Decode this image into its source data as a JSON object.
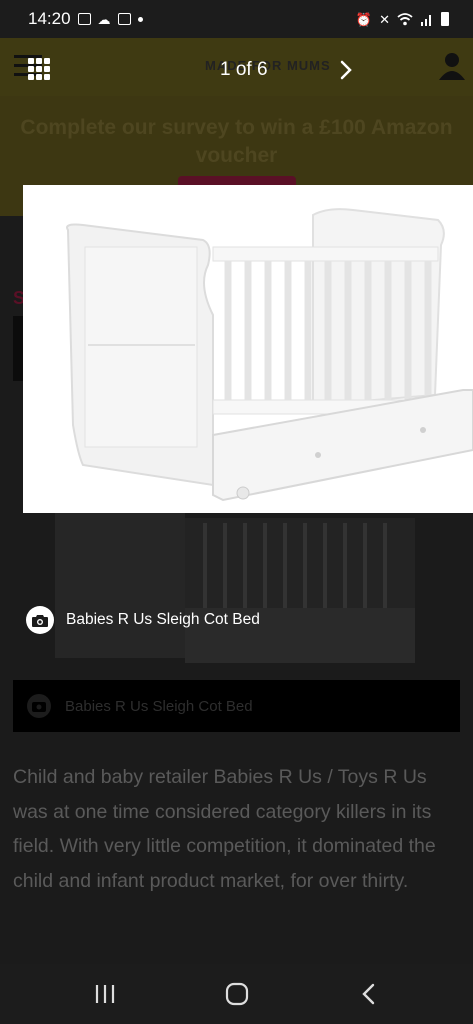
{
  "status_bar": {
    "time": "14:20",
    "left_icons": [
      "gallery-icon",
      "weather-icon",
      "mail-icon",
      "dot-icon"
    ],
    "right_icons": [
      "alarm-icon",
      "mute-icon",
      "wifi-icon",
      "signal-icon",
      "battery-icon"
    ]
  },
  "site": {
    "logo": "MADE FOR MUMS",
    "survey_text": "Complete our survey to win a £100 Amazon voucher",
    "article_letter": "S"
  },
  "overlay": {
    "counter": "1 of 6",
    "caption": "Babies R Us Sleigh Cot Bed"
  },
  "background_caption": "Babies R Us Sleigh Cot Bed",
  "article": {
    "text": "Child and baby retailer Babies R Us / Toys R Us was at one time considered category killers in its field.  With very little competition, it dominated the child and infant product market, for over thirty."
  },
  "nav": {
    "buttons": [
      "recent-apps",
      "home",
      "back"
    ]
  },
  "colors": {
    "header_yellow_dimmed": "#3f3a12",
    "accent_maroon": "#5a1026",
    "overlay_bg": "#1b1b1b"
  }
}
